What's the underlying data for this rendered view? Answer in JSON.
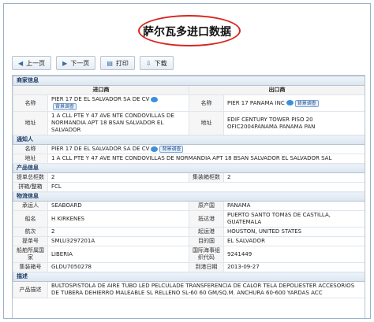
{
  "title": "萨尔瓦多进口数据",
  "toolbar": {
    "prev": "上一页",
    "next": "下一页",
    "print": "打印",
    "download": "下载"
  },
  "sections": {
    "merchant": "商家信息",
    "notify": "通知人",
    "product": "产品信息",
    "logistics": "物流信息",
    "description": "描述"
  },
  "merchant": {
    "importer_header": "进口商",
    "exporter_header": "出口商",
    "name_label": "名称",
    "address_label": "地址",
    "importer_name": "PIER 17 DE EL SALVADOR SA DE CV",
    "importer_address": "1 A CLL PTE Y 47 AVE NTE CONDOVILLAS DE NORMANDIA APT 18 BSAN SALVADOR EL SALVADOR",
    "exporter_name": "PIER 17 PANAMA INC",
    "exporter_address": "EDIF CENTURY TOWER PISO 20 OFIC2004PANAMA PANAMA PAN",
    "verify_label": "背景调查"
  },
  "notify": {
    "name_label": "名称",
    "address_label": "地址",
    "name": "PIER 17 DE EL SALVADOR SA DE CV",
    "address": "1 A CLL PTE Y 47 AVE NTE CONDOVILLAS DE NORMANDIA APT 18 BSAN SALVADOR EL SALVADOR SAL"
  },
  "product": {
    "bl_count_label": "提单总柜数",
    "bl_count": "2",
    "container_count_label": "集装箱柜数",
    "container_count": "2",
    "lcl_label": "拼箱/整箱",
    "lcl": "FCL"
  },
  "logistics": {
    "carrier_label": "承运人",
    "carrier": "SEABOARD",
    "origin_country_label": "原产国",
    "origin_country": "PANAMA",
    "vessel_label": "船名",
    "vessel": "H KIRKENES",
    "arrival_port_label": "抵达港",
    "arrival_port": "PUERTO SANTO TOMáS DE CASTILLA, GUATEMALA",
    "voyage_label": "航次",
    "voyage": "2",
    "departure_port_label": "起运港",
    "departure_port": "HOUSTON, UNITED STATES",
    "bl_no_label": "提单号",
    "bl_no": "SMLU3297201A",
    "destination_label": "目的国",
    "destination": "EL SALVADOR",
    "flag_label": "船舶所属国家",
    "flag": "LIBERIA",
    "imo_label": "国际海事组织代码",
    "imo": "9241449",
    "container_no_label": "集装箱号",
    "container_no": "GLDU7050278",
    "arrival_date_label": "到港日期",
    "arrival_date": "2013-09-27"
  },
  "description": {
    "label": "产品描述",
    "text": "BULTOSPISTOLA DE AIRE TUBO LED PELCULADE TRANSFERENCIA DE CALOR TELA DEPOLIESTER ACCESORIOS DE TUBERA DEHIERRO MALEABLE SL RELLENO SL-60 60 GM/SQ.M. ANCHURA 60-600 YARDAS ACC"
  },
  "colors": {
    "accent": "#d8261f",
    "section_text": "#1d3a63",
    "border": "#b7c3d0"
  }
}
